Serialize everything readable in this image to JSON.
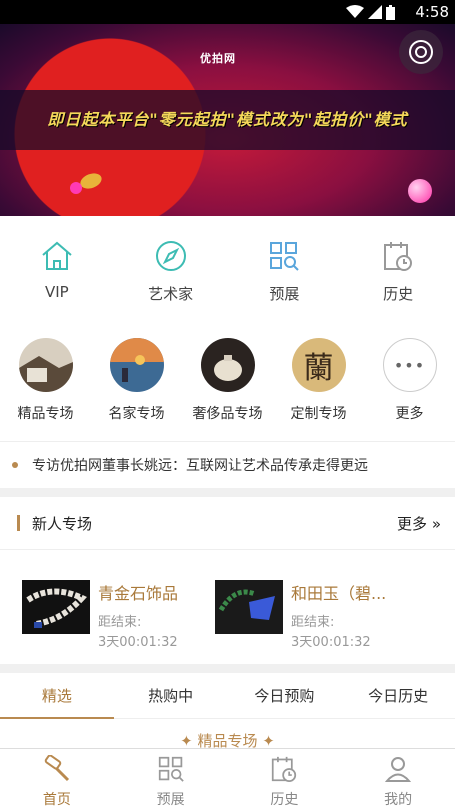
{
  "status_bar": {
    "time": "4:58"
  },
  "banner": {
    "brand": "优拍网",
    "headline": "即日起本平台\"零元起拍\"模式改为\"起拍价\"模式"
  },
  "quick_nav": [
    {
      "label": "VIP",
      "icon": "home-icon"
    },
    {
      "label": "艺术家",
      "icon": "compass-icon"
    },
    {
      "label": "预展",
      "icon": "grid-search-icon"
    },
    {
      "label": "历史",
      "icon": "calendar-clock-icon"
    }
  ],
  "categories": [
    {
      "label": "精品专场"
    },
    {
      "label": "名家专场"
    },
    {
      "label": "奢侈品专场"
    },
    {
      "label": "定制专场",
      "glyph": "蘭"
    },
    {
      "label": "更多",
      "glyph": "•••"
    }
  ],
  "news": {
    "text": "专访优拍网董事长姚远：互联网让艺术品传承走得更远"
  },
  "new_user_section": {
    "title": "新人专场",
    "more": "更多",
    "items": [
      {
        "name": "青金石饰品",
        "end_label": "距结束:",
        "countdown": "3天00:01:32"
      },
      {
        "name": "和田玉（碧...",
        "end_label": "距结束:",
        "countdown": "3天00:01:32"
      }
    ]
  },
  "tabs": [
    {
      "label": "精选"
    },
    {
      "label": "热购中"
    },
    {
      "label": "今日预购"
    },
    {
      "label": "今日历史"
    }
  ],
  "section_peek": "精品专场",
  "bottom_nav": [
    {
      "label": "首页",
      "icon": "auction-hammer-icon"
    },
    {
      "label": "预展",
      "icon": "grid-search-icon"
    },
    {
      "label": "历史",
      "icon": "calendar-clock-icon"
    },
    {
      "label": "我的",
      "icon": "user-icon"
    }
  ],
  "colors": {
    "accent": "#b98a50",
    "accent_text": "#a9793a",
    "teal": "#3dbcb3",
    "blue": "#5aa6dc"
  }
}
